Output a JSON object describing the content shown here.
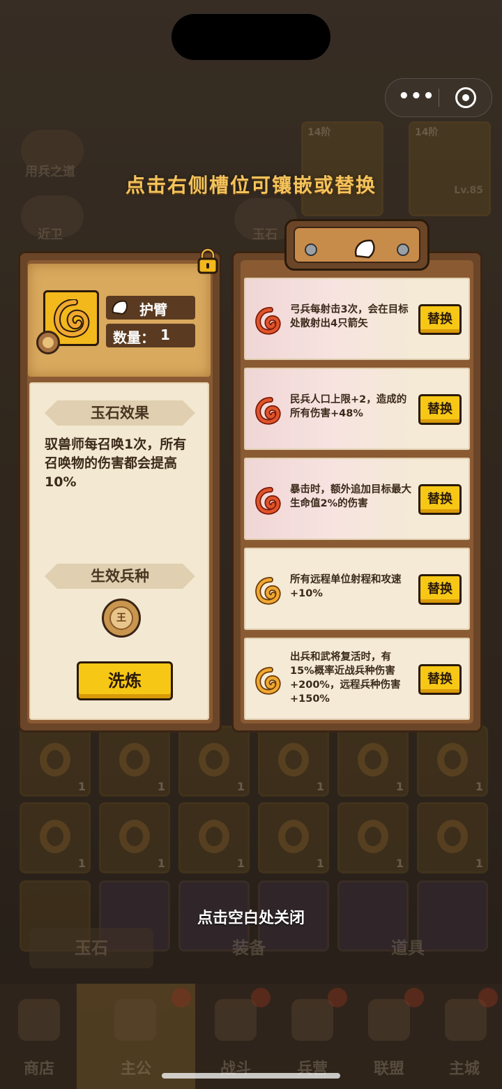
{
  "hint_title": "点击右侧槽位可镶嵌或替换",
  "close_hint": "点击空白处关闭",
  "background": {
    "left_buttons": [
      "用兵之道",
      "近卫"
    ],
    "mid_buttons": [
      "玉石"
    ],
    "cards": [
      {
        "tier": "14阶"
      },
      {
        "tier": "14阶",
        "level": "Lv.85"
      }
    ],
    "seg_tabs": [
      "玉石",
      "装备",
      "道具"
    ],
    "nav": [
      "商店",
      "主公",
      "战斗",
      "兵营",
      "联盟",
      "主城"
    ],
    "grid_counts": [
      "1",
      "1",
      "1",
      "1",
      "1",
      "1",
      "1",
      "1",
      "1",
      "1",
      "1",
      "1"
    ]
  },
  "gem": {
    "slot_name": "护臂",
    "qty_label": "数量：",
    "qty_value": "1",
    "effect_header": "玉石效果",
    "effect_text": "驭兽师每召唤1次，所有召唤物的伤害都会提高10%",
    "unit_header": "生效兵种",
    "refine_label": "洗炼"
  },
  "options": [
    {
      "desc": "弓兵每射击3次，会在目标处散射出4只箭矢",
      "swap": "替换",
      "style": "red"
    },
    {
      "desc": "民兵人口上限+2，造成的所有伤害+48%",
      "swap": "替换",
      "style": "red"
    },
    {
      "desc": "暴击时，额外追加目标最大生命值2%的伤害",
      "swap": "替换",
      "style": "red"
    },
    {
      "desc": "所有远程单位射程和攻速+10%",
      "swap": "替换",
      "style": "gold"
    },
    {
      "desc": "出兵和武将复活时，有15%概率近战兵种伤害+200%，远程兵种伤害+150%",
      "swap": "替换",
      "style": "gold"
    }
  ],
  "colors": {
    "accent_yellow": "#f7c716",
    "title_gold": "#f4c35a",
    "panel_brown": "#6b4528",
    "parchment": "#f3e8d2",
    "red_gem": "#e0542a",
    "gold_gem": "#f0a830"
  }
}
